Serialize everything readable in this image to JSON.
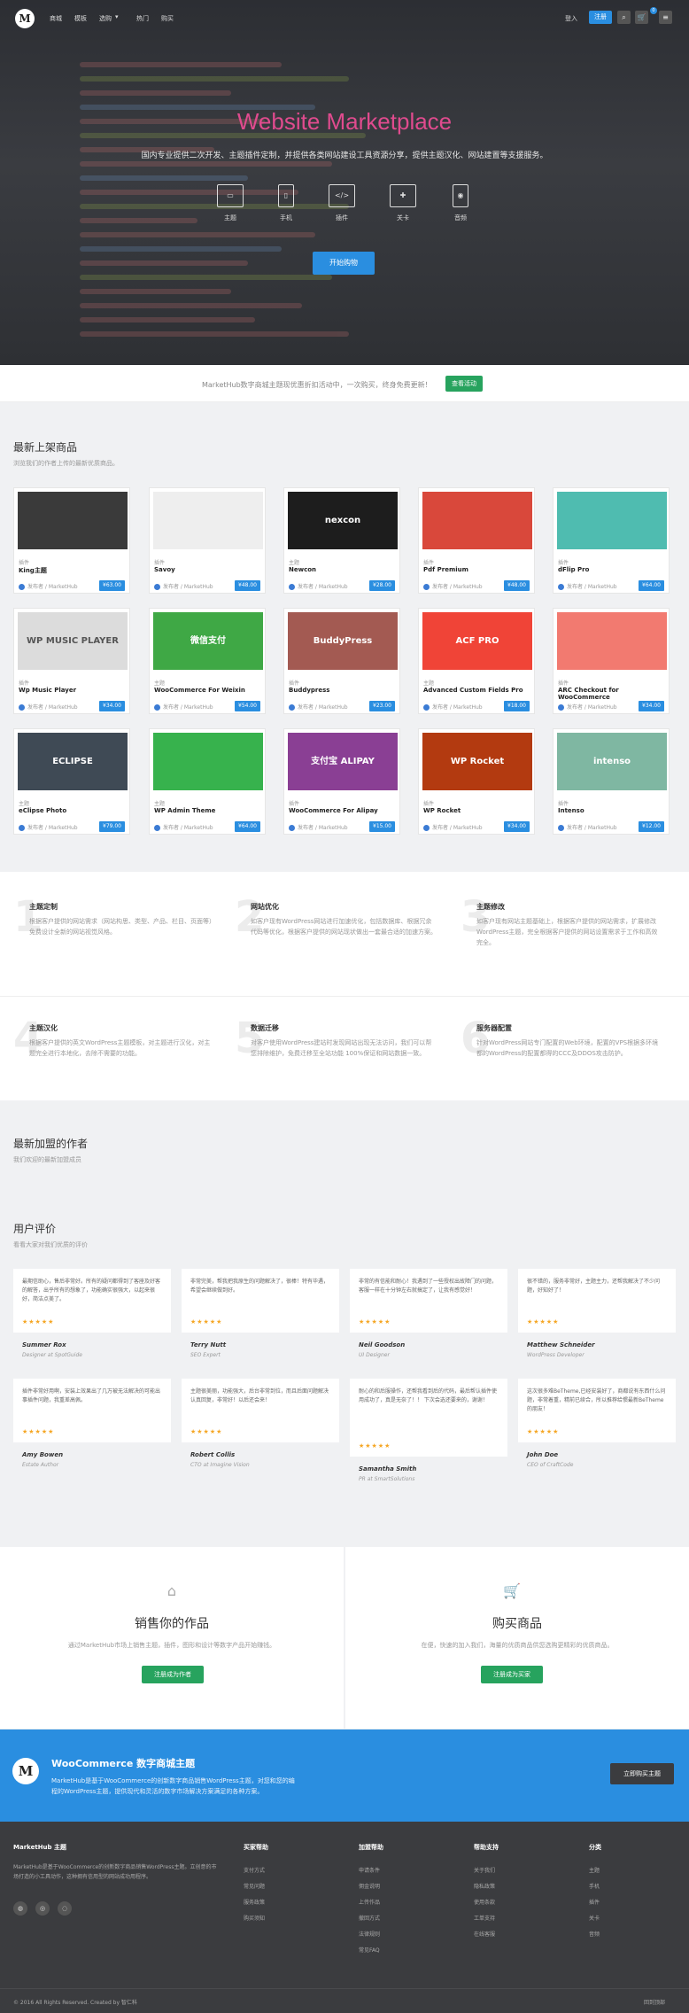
{
  "nav": {
    "items": [
      "商城",
      "模板",
      "选购",
      "热门",
      "购买"
    ],
    "login": "登入",
    "register": "注册",
    "cart_badge": "0"
  },
  "hero": {
    "title": "Website Marketplace",
    "subtitle": "国内专业提供二次开发、主题插件定制，并提供各类网站建设工具资源分享，提供主题汉化、网站建置等支援服务。",
    "categories": [
      "主题",
      "手机",
      "插件",
      "关卡",
      "音频"
    ],
    "button": "开始购物"
  },
  "promo": {
    "text": "MarketHub数字商城主题现优惠折扣活动中，一次购买，终身免费更新！",
    "button": "查看活动"
  },
  "products": {
    "title": "最新上架商品",
    "subtitle": "浏览我们的作者上传的最新优质商品。",
    "items": [
      {
        "cat": "插件",
        "name": "King主题",
        "author": "发布者 / MarketHub",
        "price": "¥63.00",
        "color": "#3a3a3a",
        "label": ""
      },
      {
        "cat": "插件",
        "name": "Savoy",
        "author": "发布者 / MarketHub",
        "price": "¥48.00",
        "color": "#eeeeee",
        "label": ""
      },
      {
        "cat": "主题",
        "name": "Newcon",
        "author": "发布者 / MarketHub",
        "price": "¥28.00",
        "color": "#1d1d1d",
        "label": "nexcon"
      },
      {
        "cat": "插件",
        "name": "Pdf Premium",
        "author": "发布者 / MarketHub",
        "price": "¥48.00",
        "color": "#d9483b",
        "label": ""
      },
      {
        "cat": "插件",
        "name": "dFlip Pro",
        "author": "发布者 / MarketHub",
        "price": "¥64.00",
        "color": "#4fbcb0",
        "label": ""
      },
      {
        "cat": "插件",
        "name": "Wp Music Player",
        "author": "发布者 / MarketHub",
        "price": "¥34.00",
        "color": "#dcdcdc",
        "label": "WP MUSIC PLAYER"
      },
      {
        "cat": "主题",
        "name": "WooCommerce For Weixin",
        "author": "发布者 / MarketHub",
        "price": "¥54.00",
        "color": "#3fa845",
        "label": "微信支付"
      },
      {
        "cat": "插件",
        "name": "Buddypress",
        "author": "发布者 / MarketHub",
        "price": "¥23.00",
        "color": "#a35a52",
        "label": "BuddyPress"
      },
      {
        "cat": "主题",
        "name": "Advanced Custom Fields Pro",
        "author": "发布者 / MarketHub",
        "price": "¥18.00",
        "color": "#f04437",
        "label": "ACF PRO"
      },
      {
        "cat": "插件",
        "name": "ARC Checkout for WooCommerce",
        "author": "发布者 / MarketHub",
        "price": "¥34.00",
        "color": "#f27a70",
        "label": ""
      },
      {
        "cat": "主题",
        "name": "eClipse Photo",
        "author": "发布者 / MarketHub",
        "price": "¥79.00",
        "color": "#3f4a55",
        "label": "ECLIPSE"
      },
      {
        "cat": "主题",
        "name": "WP Admin Theme",
        "author": "发布者 / MarketHub",
        "price": "¥64.00",
        "color": "#37b24d",
        "label": ""
      },
      {
        "cat": "插件",
        "name": "WooCommerce For Alipay",
        "author": "发布者 / MarketHub",
        "price": "¥15.00",
        "color": "#8a3f94",
        "label": "支付宝 ALIPAY"
      },
      {
        "cat": "插件",
        "name": "WP Rocket",
        "author": "发布者 / MarketHub",
        "price": "¥34.00",
        "color": "#b33a10",
        "label": "WP Rocket"
      },
      {
        "cat": "插件",
        "name": "Intenso",
        "author": "发布者 / MarketHub",
        "price": "¥12.00",
        "color": "#7fb7a2",
        "label": "intenso"
      }
    ]
  },
  "services": [
    {
      "num": "1",
      "title": "主题定制",
      "desc": "根据客户提供的网站需求（网站构思、类型、产品、栏目、页面等）免费设计全新的网站视觉风格。"
    },
    {
      "num": "2",
      "title": "网站优化",
      "desc": "如客户现有WordPress网站进行加速优化，包括数据库、根据冗余代码等优化，根据客户提供的网站现状做出一套最合适的加速方案。"
    },
    {
      "num": "3",
      "title": "主题修改",
      "desc": "如客户现有网站主题基础上，根据客户提供的网站需求，扩展修改WordPress主题，完全根据客户提供的网站设置需求于工作和高效完全。"
    },
    {
      "num": "4",
      "title": "主题汉化",
      "desc": "根据客户提供的英文WordPress主题模板，对主题进行汉化，对主题完全进行本地化，去除不需要的功能。"
    },
    {
      "num": "5",
      "title": "数据迁移",
      "desc": "对客户使用WordPress建站时发现网站出现无法访问，我们可以帮您排除维护，免费迁移至全站功能 100%保证和网站数据一致。"
    },
    {
      "num": "6",
      "title": "服务器配置",
      "desc": "针对WordPress网站专门配置的Web环境，配置的VPS根据多环境都的WordPress的配置都得的CCC及DDOS攻击防护。"
    }
  ],
  "authors": {
    "title": "最新加盟的作者",
    "subtitle": "我们欢迎的最新加盟成员"
  },
  "reviews": {
    "title": "用户评价",
    "subtitle": "看看大家对我们优质的评价",
    "items": [
      {
        "text": "最期信助心，售后非常好。所有的疑问都得到了客座及好客的解答，出乎所有的想象了，功能确实很强大，以起来很好，简洁点美了。",
        "name": "Summer Rox",
        "role": "Designer at SpotGuide"
      },
      {
        "text": "非常完美，帮我把我原生的问题解决了，很棒！特有毕遇，希望会继续做到好。",
        "name": "Terry Nutt",
        "role": "SEO Expert"
      },
      {
        "text": "非常的有信能和耐心！我遇到了一些授权出故障门的问题，客服一样在十分钟左右就搞定了，让我有感觉好！",
        "name": "Neil Goodson",
        "role": "UI Designer"
      },
      {
        "text": "很不错的，服务非常好，主题主力，还帮我解决了不少问题，好知好了！",
        "name": "Matthew Schneider",
        "role": "WordPress Developer"
      },
      {
        "text": "插件非常好用啊，安装上效果出了几万被无法解决的可能出事插件问题，我重差高佩。",
        "name": "Amy Bowen",
        "role": "Estate Author"
      },
      {
        "text": "主题很美丽，功能强大，后台非常到位，而且后面问题解决认真回复，非常好！以后还会来！",
        "name": "Robert Collis",
        "role": "CTO at Imagine Vision"
      },
      {
        "text": "耐心的和后服操作，还帮我看到后的代码，最后帮认插件使用成功了，真是无奈了！！ 下次会选还要来的，谢谢！",
        "name": "Samantha Smith",
        "role": "PR at SmartSolutions"
      },
      {
        "text": "这次很多难BeTheme,已经安装好了，商都说有东西什么问题，非常着重，精前已续合，所以推荐给惯最新BeTheme的朋友！",
        "name": "John Doe",
        "role": "CEO of CraftCode"
      }
    ]
  },
  "cta": {
    "sell_title": "销售你的作品",
    "sell_desc": "通过MarketHub市场上销售主题，插件，图形和设计等数字产品开始赚钱。",
    "sell_button": "注册成为作者",
    "buy_title": "购买商品",
    "buy_desc": "在便，快速的加入我们，海量的优质商品供您选购更精彩的优质商品。",
    "buy_button": "注册成为买家"
  },
  "banner": {
    "title": "WooCommerce 数字商城主题",
    "desc": "MarketHub是基于WooCommerce的创新数字商品销售WordPress主题，对您和您的编程的WordPress主题，提供现代和灵活的数字市场解决方案满足的各种方案。",
    "button": "立即购买主题"
  },
  "footer": {
    "about_title": "MarketHub 主题",
    "about_text": "MarketHub是基于WooCommerce的创新数字商品销售WordPress主题。立创意的市场打造的小工具动作，这种拥有信用型的网站成功用程序。",
    "cols": [
      {
        "title": "买家帮助",
        "links": [
          "支付方式",
          "常见问题",
          "服务政策",
          "购买须知"
        ]
      },
      {
        "title": "加盟帮助",
        "links": [
          "申请条件",
          "佣金说明",
          "上传作品",
          "撤回方式",
          "法律规则",
          "常见FAQ"
        ]
      },
      {
        "title": "帮助支持",
        "links": [
          "关于我们",
          "隐私政策",
          "使用条款",
          "工单支持",
          "在线客服"
        ]
      },
      {
        "title": "分类",
        "links": [
          "主题",
          "手机",
          "插件",
          "关卡",
          "音频"
        ]
      }
    ],
    "copyright": "© 2016 All Rights Reserved. Created by 智仁科",
    "top": "回到顶部"
  }
}
